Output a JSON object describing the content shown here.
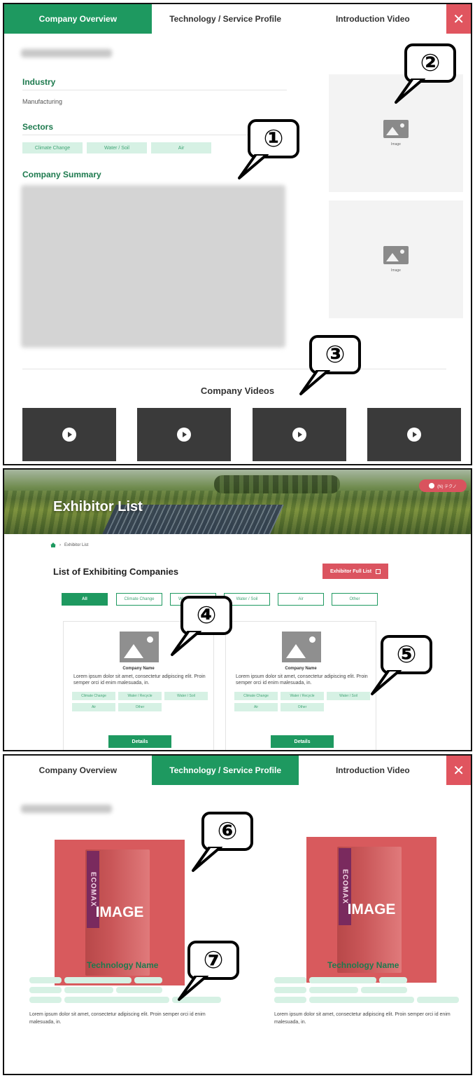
{
  "panel1": {
    "tabs": [
      "Company Overview",
      "Technology / Service Profile",
      "Introduction Video"
    ],
    "active_tab": 0,
    "close_glyph": "✕",
    "industry_title": "Industry",
    "industry_value": "Manufacturing",
    "sectors_title": "Sectors",
    "sectors": [
      "Climate Change",
      "Water / Soil",
      "Air"
    ],
    "summary_title": "Company Summary",
    "image_caption": "Image",
    "videos_title": "Company Videos",
    "callouts": [
      "①",
      "②",
      "③"
    ]
  },
  "panel2": {
    "banner_title": "Exhibitor List",
    "login_label": "(N) テクノ",
    "breadcrumb": "Exhibitor List",
    "list_title": "List of Exhibiting Companies",
    "full_list_button": "Exhibitor Full List",
    "filters": [
      "All",
      "Climate Change",
      "Water / Recycle",
      "Water / Soil",
      "Air",
      "Other"
    ],
    "cards": [
      {
        "name": "Company Name",
        "desc": "Lorem ipsum dolor sit amet, consectetur adipiscing elit. Proin semper orci id enim malesuada, in.",
        "tags": [
          "Climate Change",
          "Water / Recycle",
          "Water / Soil",
          "Air",
          "Other"
        ],
        "button": "Details"
      },
      {
        "name": "Company Name",
        "desc": "Lorem ipsum dolor sit amet, consectetur adipiscing elit. Proin semper orci id enim malesuada, in.",
        "tags": [
          "Climate Change",
          "Water / Recycle",
          "Water / Soil",
          "Air",
          "Other"
        ],
        "button": "Details"
      }
    ],
    "callouts": [
      "④",
      "⑤"
    ]
  },
  "panel3": {
    "tabs": [
      "Company Overview",
      "Technology / Service Profile",
      "Introduction Video"
    ],
    "active_tab": 1,
    "close_glyph": "✕",
    "image_label": "IMAGE",
    "brand_text": "ECOMAX",
    "tech_title": "Technology Name",
    "desc": "Lorem ipsum dolor sit amet, consectetur adipiscing elit. Proin semper orci id enim malesuada, in.",
    "callouts": [
      "⑥",
      "⑦"
    ]
  },
  "colors": {
    "brand_green": "#1e9960",
    "close_red": "#e0555f",
    "tag_bg": "#d6f1e4",
    "image_red": "#d85a5d"
  }
}
